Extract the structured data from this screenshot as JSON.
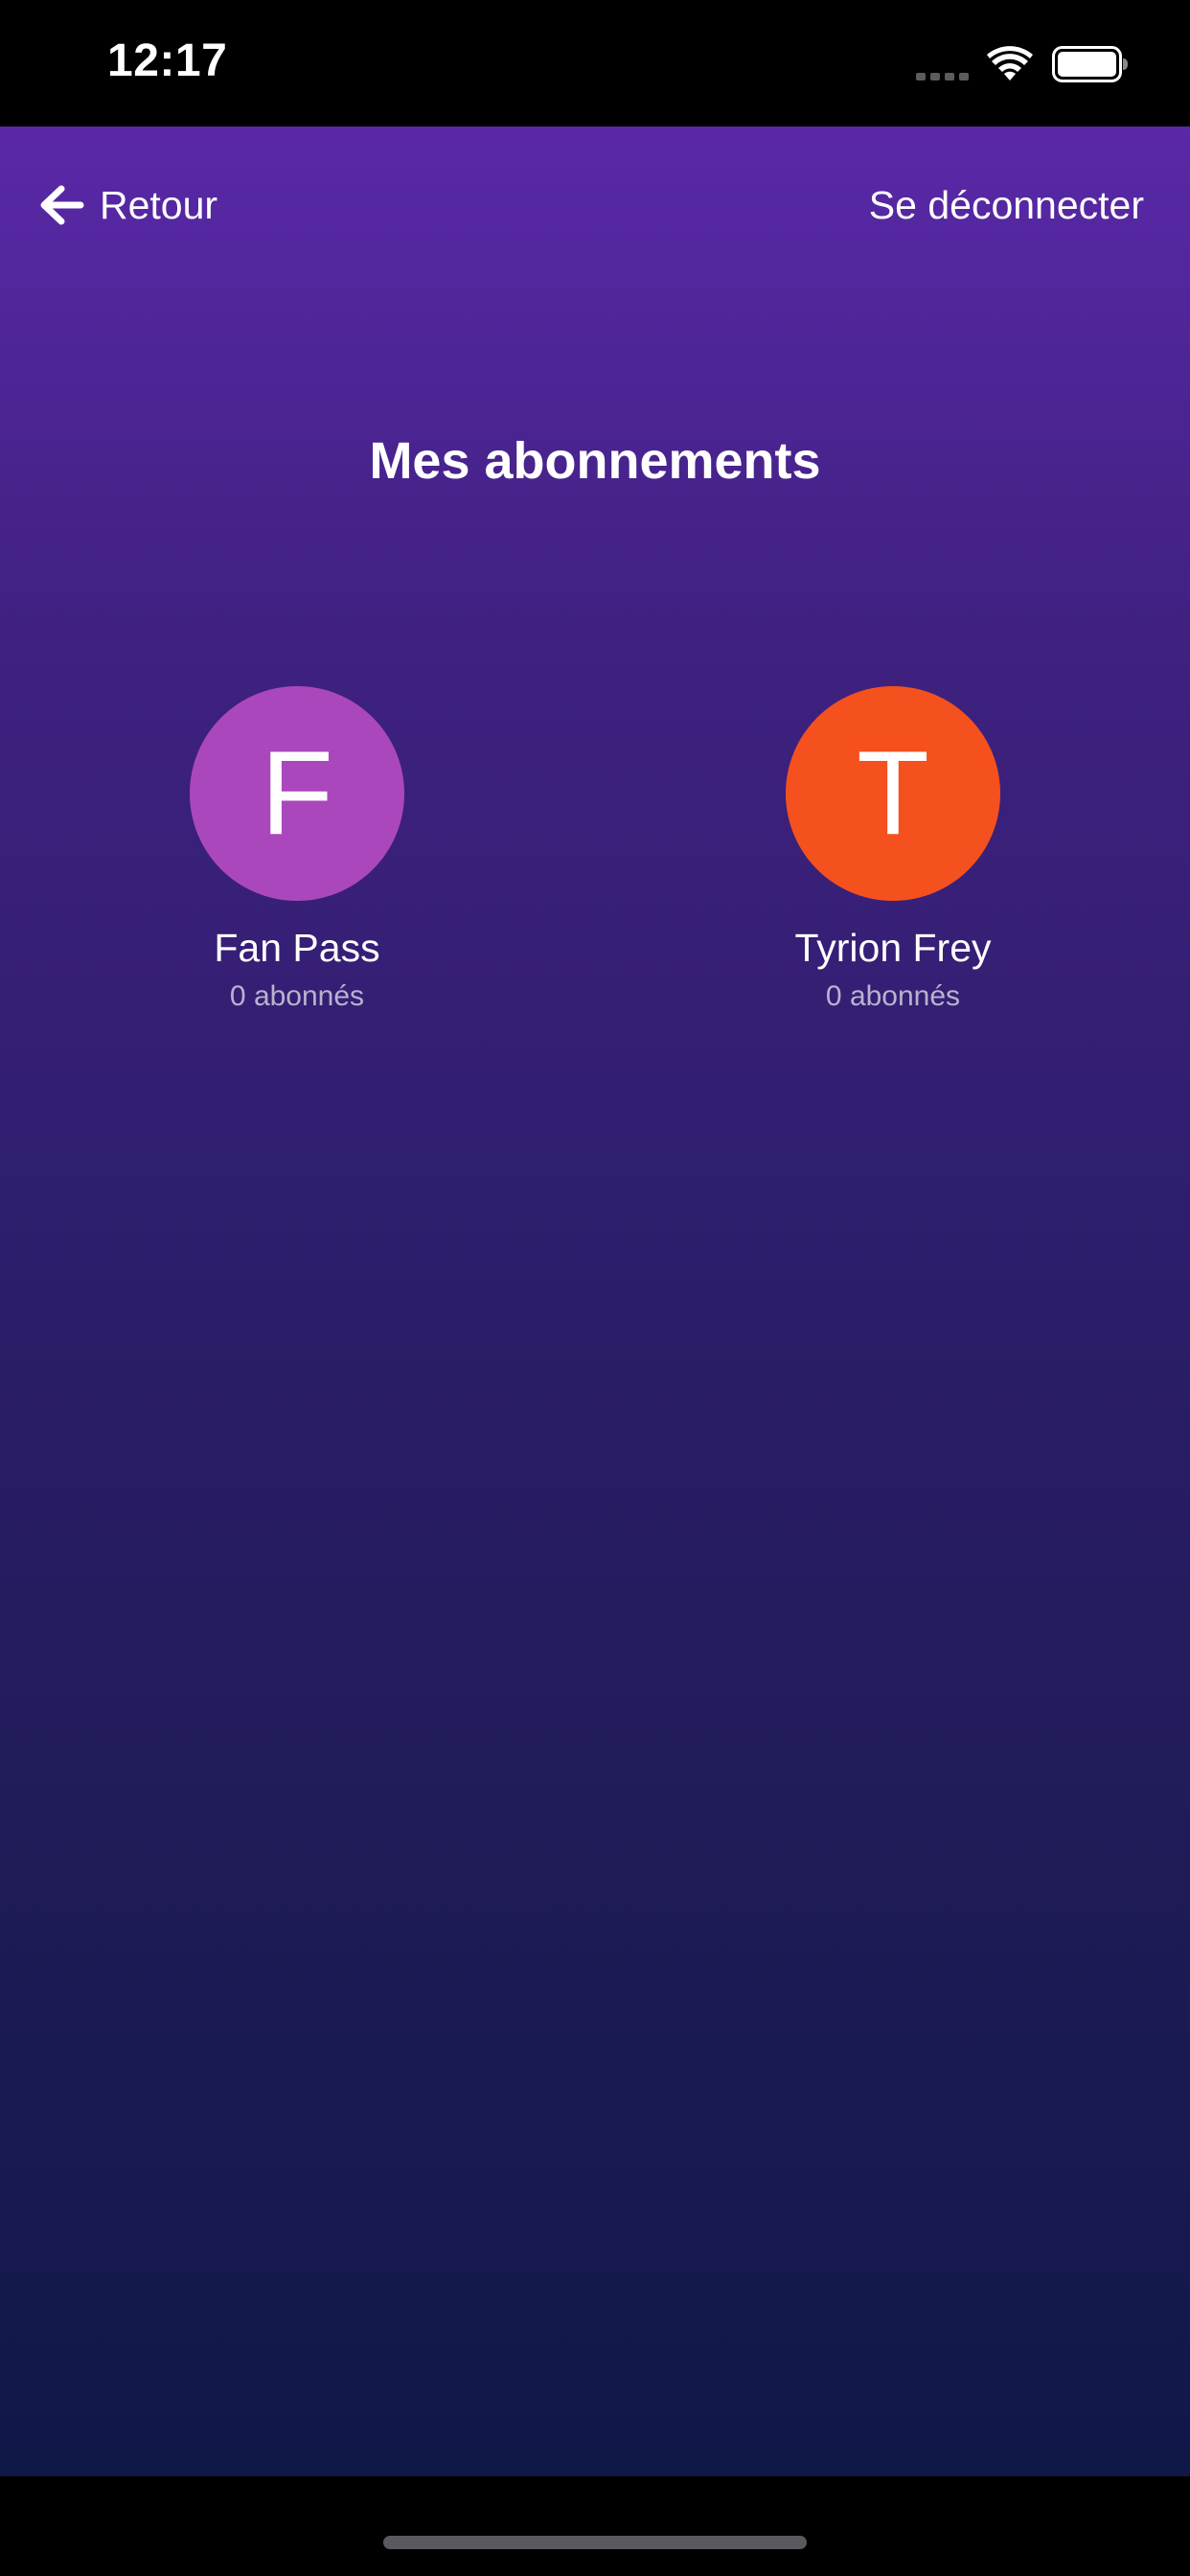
{
  "status_bar": {
    "time": "12:17",
    "icons": [
      "signal-icon",
      "wifi-icon",
      "battery-icon"
    ]
  },
  "nav": {
    "back_label": "Retour",
    "back_icon": "arrow-left-icon",
    "logout_label": "Se déconnecter"
  },
  "page": {
    "title": "Mes abonnements"
  },
  "subscriptions": [
    {
      "initial": "F",
      "name": "Fan Pass",
      "count": "0 abonnés",
      "color": "#ab47bc"
    },
    {
      "initial": "T",
      "name": "Tyrion Frey",
      "count": "0 abonnés",
      "color": "#f4511e"
    }
  ],
  "theme": {
    "gradient_top": "#5a28a8",
    "gradient_bottom": "#101848",
    "text_color": "#ffffff",
    "muted_text_color": "#b9b2cf"
  }
}
